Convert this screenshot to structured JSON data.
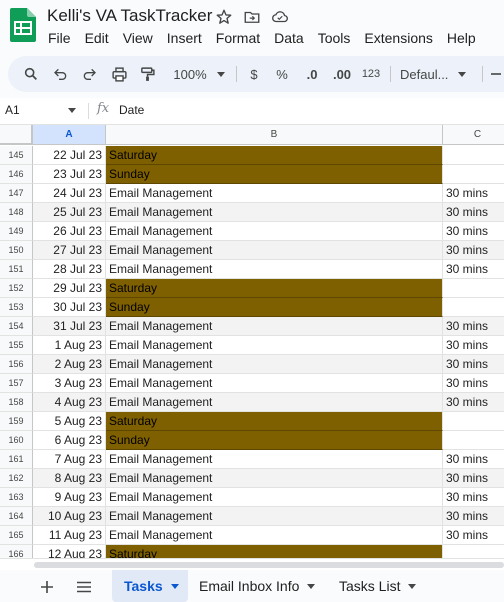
{
  "app": {
    "title": "Kelli's VA TaskTracker",
    "menu": [
      "File",
      "Edit",
      "View",
      "Insert",
      "Format",
      "Data",
      "Tools",
      "Extensions",
      "Help"
    ]
  },
  "toolbar": {
    "zoom": "100%",
    "currency": "$",
    "percent": "%",
    "decrease_decimal": ".0",
    "increase_decimal": ".00",
    "number_format": "123",
    "font": "Defaul..."
  },
  "formula_bar": {
    "cell_ref": "A1",
    "fx": "fx",
    "value": "Date"
  },
  "columns": [
    "A",
    "B",
    "C"
  ],
  "rows": [
    {
      "num": "145",
      "date": "22 Jul 23",
      "task": "Saturday",
      "time": "",
      "weekend": true
    },
    {
      "num": "146",
      "date": "23 Jul 23",
      "task": "Sunday",
      "time": "",
      "weekend": true
    },
    {
      "num": "147",
      "date": "24 Jul 23",
      "task": "Email Management",
      "time": "30 mins",
      "weekend": false
    },
    {
      "num": "148",
      "date": "25 Jul 23",
      "task": "Email Management",
      "time": "30 mins",
      "weekend": false
    },
    {
      "num": "149",
      "date": "26 Jul 23",
      "task": "Email Management",
      "time": "30 mins",
      "weekend": false
    },
    {
      "num": "150",
      "date": "27 Jul 23",
      "task": "Email Management",
      "time": "30 mins",
      "weekend": false
    },
    {
      "num": "151",
      "date": "28 Jul 23",
      "task": "Email Management",
      "time": "30 mins",
      "weekend": false
    },
    {
      "num": "152",
      "date": "29 Jul 23",
      "task": "Saturday",
      "time": "",
      "weekend": true
    },
    {
      "num": "153",
      "date": "30 Jul 23",
      "task": "Sunday",
      "time": "",
      "weekend": true
    },
    {
      "num": "154",
      "date": "31 Jul 23",
      "task": "Email Management",
      "time": "30 mins",
      "weekend": false
    },
    {
      "num": "155",
      "date": "1 Aug 23",
      "task": "Email Management",
      "time": "30 mins",
      "weekend": false
    },
    {
      "num": "156",
      "date": "2 Aug 23",
      "task": "Email Management",
      "time": "30 mins",
      "weekend": false
    },
    {
      "num": "157",
      "date": "3 Aug 23",
      "task": "Email Management",
      "time": "30 mins",
      "weekend": false
    },
    {
      "num": "158",
      "date": "4 Aug 23",
      "task": "Email Management",
      "time": "30 mins",
      "weekend": false
    },
    {
      "num": "159",
      "date": "5 Aug 23",
      "task": "Saturday",
      "time": "",
      "weekend": true
    },
    {
      "num": "160",
      "date": "6 Aug 23",
      "task": "Sunday",
      "time": "",
      "weekend": true
    },
    {
      "num": "161",
      "date": "7 Aug 23",
      "task": "Email Management",
      "time": "30 mins",
      "weekend": false
    },
    {
      "num": "162",
      "date": "8 Aug 23",
      "task": "Email Management",
      "time": "30 mins",
      "weekend": false
    },
    {
      "num": "163",
      "date": "9 Aug 23",
      "task": "Email Management",
      "time": "30 mins",
      "weekend": false
    },
    {
      "num": "164",
      "date": "10 Aug 23",
      "task": "Email Management",
      "time": "30 mins",
      "weekend": false
    },
    {
      "num": "165",
      "date": "11 Aug 23",
      "task": "Email Management",
      "time": "30 mins",
      "weekend": false
    },
    {
      "num": "166",
      "date": "12 Aug 23",
      "task": "Saturday",
      "time": "",
      "weekend": true
    }
  ],
  "sheets": [
    {
      "label": "Tasks",
      "active": true
    },
    {
      "label": "Email Inbox Info",
      "active": false
    },
    {
      "label": "Tasks List",
      "active": false
    }
  ],
  "colors": {
    "weekend_fill": "#7f6000",
    "alt_row": "#f3f3f3",
    "accent": "#0b57d0",
    "logo_green": "#0f9d58"
  },
  "icons": [
    "sheets-logo-icon",
    "star-icon",
    "move-folder-icon",
    "cloud-status-icon",
    "search-icon",
    "undo-icon",
    "redo-icon",
    "print-icon",
    "paint-format-icon",
    "add-sheet-icon",
    "all-sheets-icon"
  ]
}
